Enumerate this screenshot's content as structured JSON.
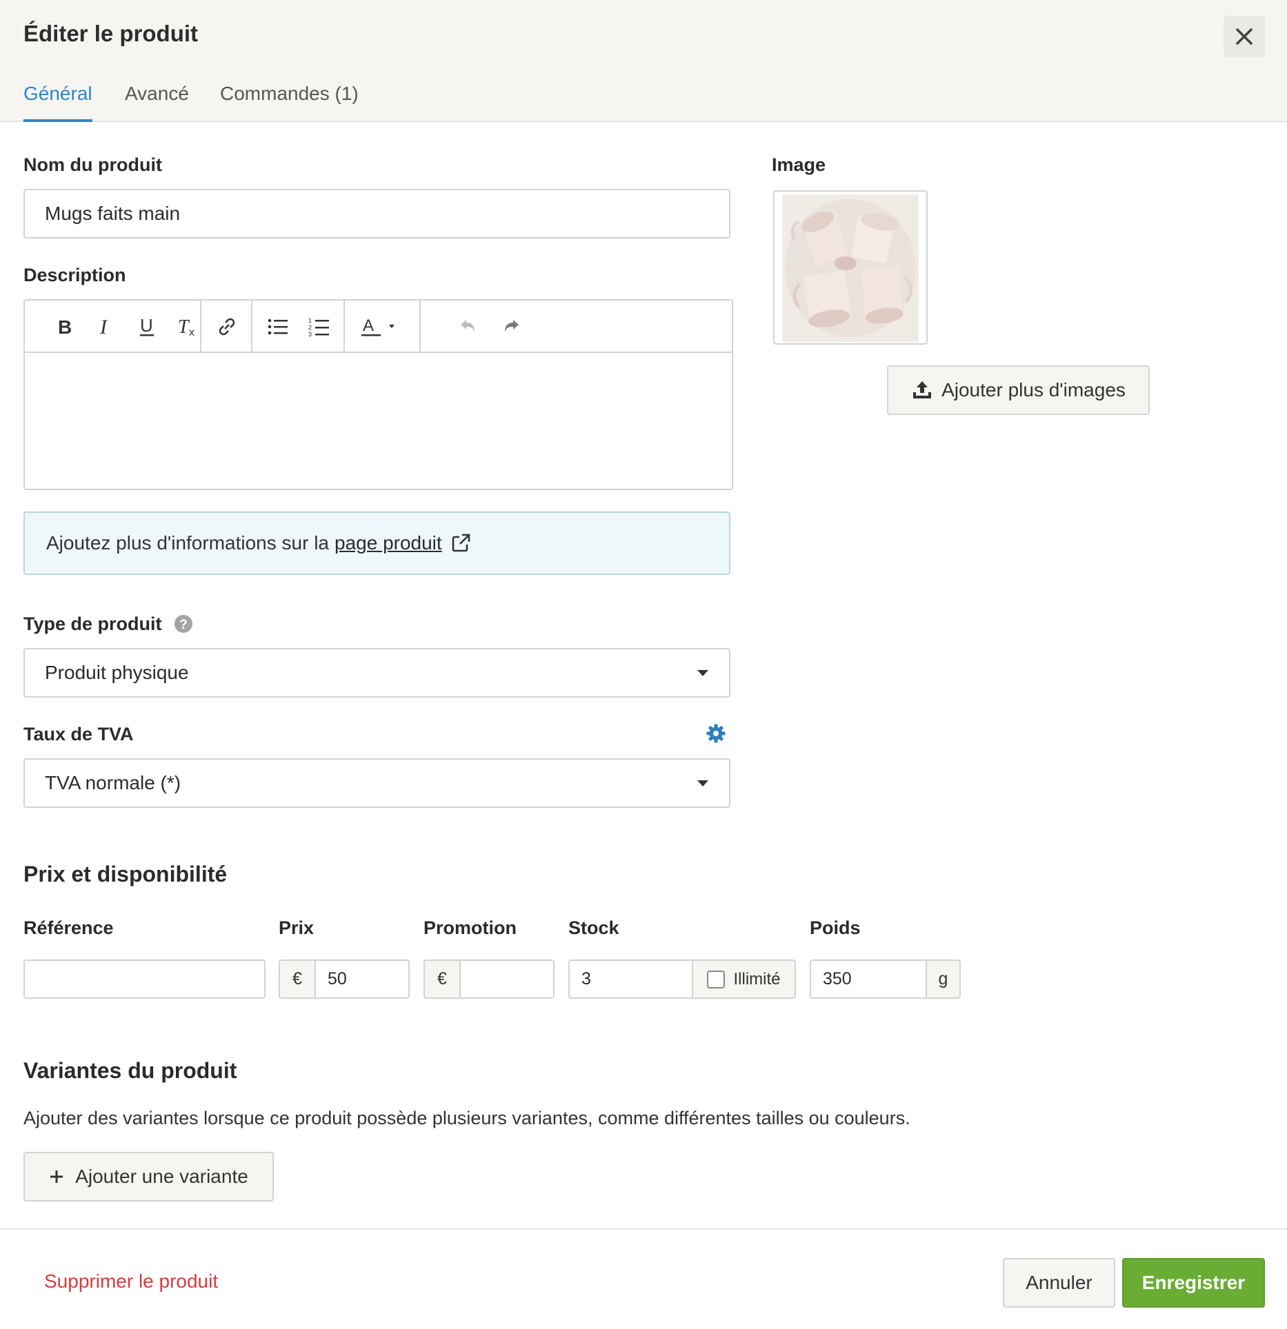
{
  "dialog": {
    "title": "Éditer le produit"
  },
  "tabs": [
    {
      "label": "Général",
      "active": true
    },
    {
      "label": "Avancé",
      "active": false
    },
    {
      "label": "Commandes (1)",
      "active": false
    }
  ],
  "product_name": {
    "label": "Nom du produit",
    "value": "Mugs faits main"
  },
  "description": {
    "label": "Description",
    "toolbar": [
      "bold-icon",
      "italic-icon",
      "underline-icon",
      "clear-format-icon",
      "link-icon",
      "bullet-list-icon",
      "numbered-list-icon",
      "text-color-icon",
      "undo-icon",
      "redo-icon"
    ],
    "value": ""
  },
  "info_box": {
    "text": "Ajoutez plus d'informations sur la",
    "link": "page produit"
  },
  "product_type": {
    "label": "Type de produit",
    "value": "Produit physique"
  },
  "vat": {
    "label": "Taux de TVA",
    "value": "TVA normale (*)"
  },
  "image": {
    "label": "Image",
    "add_button": "Ajouter plus d'images"
  },
  "pricing": {
    "heading": "Prix et disponibilité",
    "reference": {
      "label": "Référence",
      "value": ""
    },
    "price": {
      "label": "Prix",
      "currency": "€",
      "value": "50"
    },
    "promotion": {
      "label": "Promotion",
      "currency": "€",
      "value": ""
    },
    "stock": {
      "label": "Stock",
      "value": "3",
      "unlimited_label": "Illimité",
      "unlimited": false
    },
    "weight": {
      "label": "Poids",
      "value": "350",
      "unit": "g"
    }
  },
  "variants": {
    "heading": "Variantes du produit",
    "description": "Ajouter des variantes lorsque ce produit possède plusieurs variantes, comme différentes tailles ou couleurs.",
    "add_button": "Ajouter une variante"
  },
  "footer": {
    "delete_label": "Supprimer le produit",
    "cancel_label": "Annuler",
    "save_label": "Enregistrer"
  },
  "colors": {
    "accent": "#2e86c9",
    "save": "#6aad35",
    "danger": "#d93b3b"
  }
}
